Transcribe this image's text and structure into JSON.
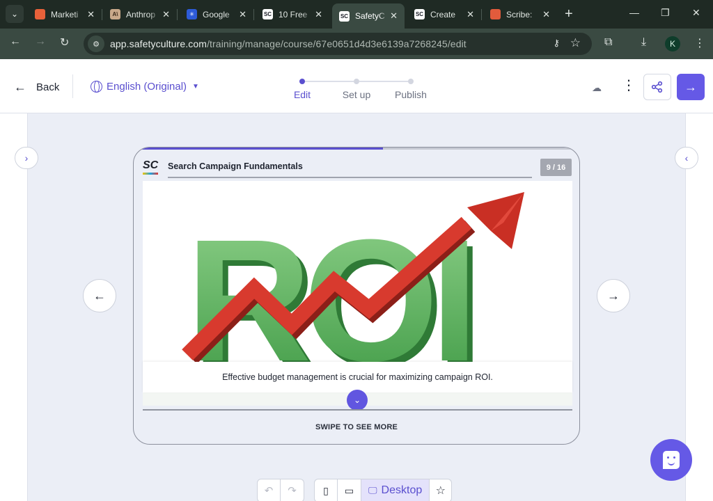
{
  "browser": {
    "tabs": [
      {
        "title": "Marketi",
        "favicon_color": "#e8613a",
        "favicon_glyph": ""
      },
      {
        "title": "Anthrop",
        "favicon_color": "#c9a98a",
        "favicon_glyph": "A\\"
      },
      {
        "title": "Google",
        "favicon_color": "#2d5bd8",
        "favicon_glyph": "✳"
      },
      {
        "title": "10 Free",
        "favicon_color": "#ffffff",
        "favicon_glyph": "SC"
      },
      {
        "title": "SafetyC",
        "favicon_color": "#ffffff",
        "favicon_glyph": "SC",
        "active": true
      },
      {
        "title": "Create",
        "favicon_color": "#ffffff",
        "favicon_glyph": "SC"
      },
      {
        "title": "Scribe:",
        "favicon_color": "#e25b3c",
        "favicon_glyph": ""
      }
    ],
    "url_host": "app.safetyculture.com",
    "url_path": "/training/manage/course/67e0651d4d3e6139a7268245/edit",
    "profile_initial": "K"
  },
  "header": {
    "back_label": "Back",
    "language_label": "English (Original)",
    "steps": [
      {
        "label": "Edit",
        "active": true
      },
      {
        "label": "Set up",
        "active": false
      },
      {
        "label": "Publish",
        "active": false
      }
    ]
  },
  "slide": {
    "brand": "SC",
    "course_title": "Search Campaign Fundamentals",
    "page_indicator": "9 / 16",
    "progress_fraction": 0.56,
    "image_text": "ROI",
    "caption": "Effective budget management is crucial for maximizing campaign ROI.",
    "swipe_hint": "SWIPE TO SEE MORE"
  },
  "view_controls": {
    "desktop_label": "Desktop"
  },
  "colors": {
    "accent": "#5a4fcf",
    "accent_button": "#6559e6",
    "roi_green": "#5cb85c",
    "arrow_red": "#d83a2e"
  }
}
